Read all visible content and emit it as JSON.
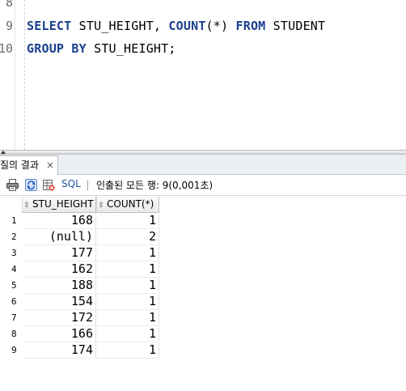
{
  "editor": {
    "lines": [
      {
        "number": "8",
        "code": []
      },
      {
        "number": "9",
        "code": [
          {
            "text": "SELECT",
            "kw": true
          },
          {
            "text": " STU_HEIGHT, ",
            "kw": false
          },
          {
            "text": "COUNT",
            "kw": true
          },
          {
            "text": "(*) ",
            "kw": false
          },
          {
            "text": "FROM",
            "kw": true
          },
          {
            "text": " STUDENT",
            "kw": false
          }
        ]
      },
      {
        "number": "10",
        "code": [
          {
            "text": "GROUP BY",
            "kw": true
          },
          {
            "text": " STU_HEIGHT;",
            "kw": false
          }
        ]
      }
    ]
  },
  "results_tab": {
    "label": "질의 결과",
    "close": "×"
  },
  "toolbar": {
    "icons": [
      "print-icon",
      "refresh-icon",
      "delete-results-icon"
    ],
    "sql_label": "SQL",
    "status": "인출된 모든 행: 9(0,001초)"
  },
  "grid": {
    "columns": [
      "STU_HEIGHT",
      "COUNT(*)"
    ],
    "rows": [
      {
        "n": "1",
        "height": "168",
        "count": "1"
      },
      {
        "n": "2",
        "height": "(null)",
        "count": "2"
      },
      {
        "n": "3",
        "height": "177",
        "count": "1"
      },
      {
        "n": "4",
        "height": "162",
        "count": "1"
      },
      {
        "n": "5",
        "height": "188",
        "count": "1"
      },
      {
        "n": "6",
        "height": "154",
        "count": "1"
      },
      {
        "n": "7",
        "height": "172",
        "count": "1"
      },
      {
        "n": "8",
        "height": "166",
        "count": "1"
      },
      {
        "n": "9",
        "height": "174",
        "count": "1"
      }
    ]
  },
  "colors": {
    "keyword": "#1a3f8f",
    "sql_label": "#1c4fa0"
  }
}
